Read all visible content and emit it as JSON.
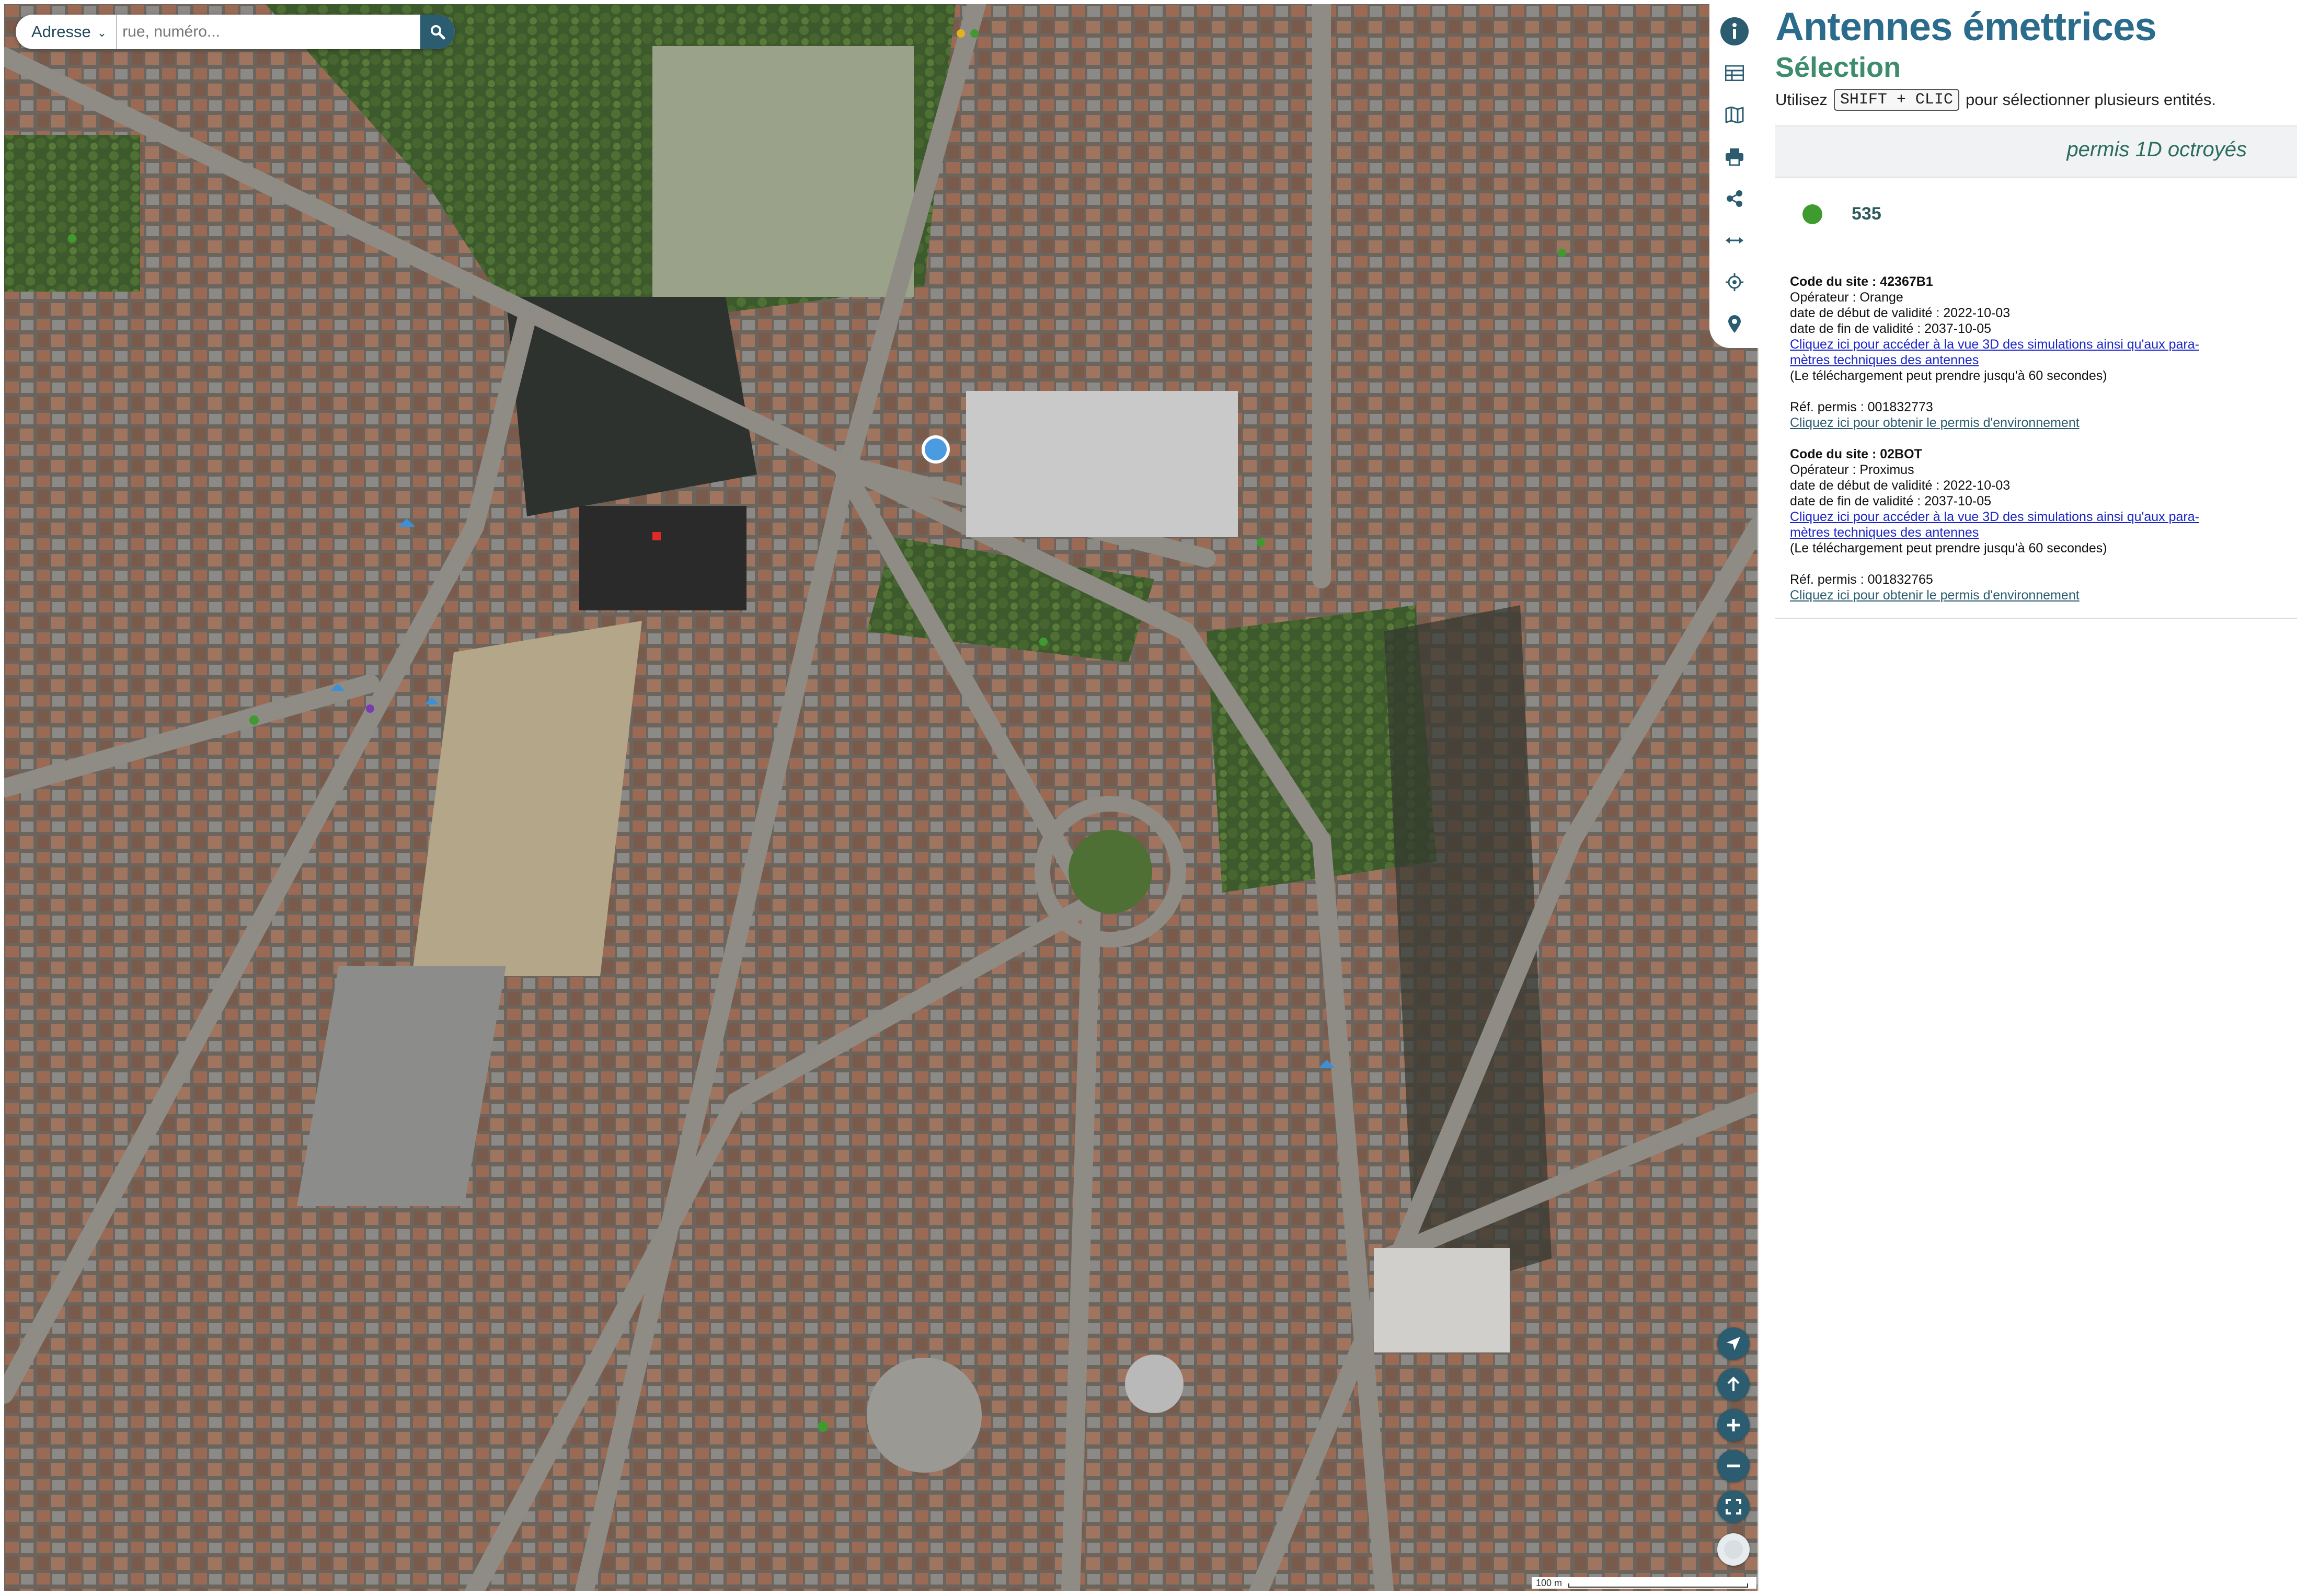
{
  "search": {
    "type_label": "Adresse",
    "placeholder": "rue, numéro..."
  },
  "toolbar": {
    "icons": [
      "info-icon",
      "table-icon",
      "map-icon",
      "print-icon",
      "share-icon",
      "measure-icon",
      "locate-icon",
      "pin-icon"
    ]
  },
  "nav": {
    "icons": [
      "navigate-icon",
      "north-arrow-icon",
      "zoom-in-icon",
      "zoom-out-icon",
      "fullscreen-icon",
      "basemap-icon"
    ]
  },
  "scale": {
    "label": "100 m"
  },
  "panel": {
    "title": "Antennes émettrices",
    "subtitle": "Sélection",
    "hint_before": "Utilisez",
    "hint_key": "SHIFT + CLIC",
    "hint_after": "pour sélectionner plusieurs entités.",
    "layer": "permis 1D octroyés",
    "legend_count": "535",
    "legend_color": "#3f9b2f",
    "sites": [
      {
        "code": "Code du site : 42367B1",
        "operator": "Opérateur : Orange",
        "start": "date de début de validité : 2022-10-03",
        "end": "date de fin de validité : 2037-10-05",
        "link3d_1": "Cliquez ici pour accéder à la vue 3D des simulations ainsi qu'aux para-",
        "link3d_2": "mètres techniques des antennes",
        "download_note": "(Le téléchargement peut prendre jusqu'à 60 secondes)",
        "ref": "Réf. permis : 001832773",
        "env_link": "Cliquez ici pour obtenir le permis d'environnement"
      },
      {
        "code": "Code du site : 02BOT",
        "operator": "Opérateur : Proximus",
        "start": "date de début de validité : 2022-10-03",
        "end": "date de fin de validité : 2037-10-05",
        "link3d_1": "Cliquez ici pour accéder à la vue 3D des simulations ainsi qu'aux para-",
        "link3d_2": "mètres techniques des antennes",
        "download_note": "(Le téléchargement peut prendre jusqu'à 60 secondes)",
        "ref": "Réf. permis : 001832765",
        "env_link": "Cliquez ici pour obtenir le permis d'environnement"
      }
    ]
  },
  "colors": {
    "accent": "#2b5c70",
    "title": "#2b6c8c",
    "subtitle": "#3d8c6c",
    "selected_marker": "#4a9be0"
  }
}
